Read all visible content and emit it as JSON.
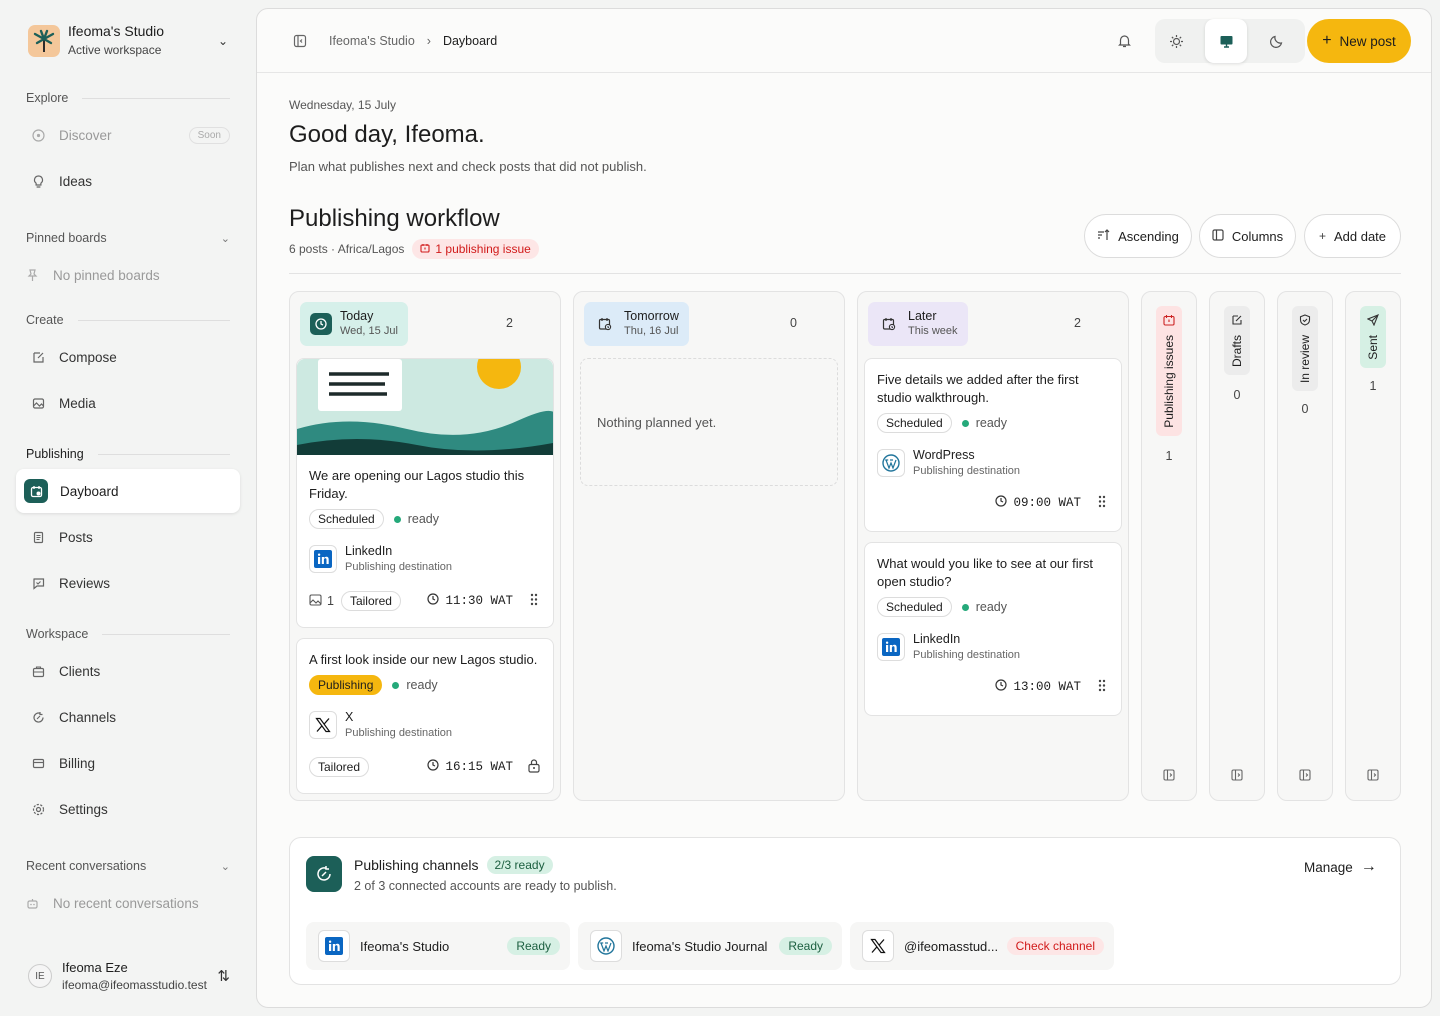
{
  "workspace": {
    "name": "Ifeoma's Studio",
    "subtitle": "Active workspace"
  },
  "sidebar": {
    "explore_label": "Explore",
    "discover": "Discover",
    "discover_badge": "Soon",
    "ideas": "Ideas",
    "pinned_label": "Pinned boards",
    "no_pinned": "No pinned boards",
    "create_label": "Create",
    "compose": "Compose",
    "media": "Media",
    "publishing_label": "Publishing",
    "dayboard": "Dayboard",
    "posts": "Posts",
    "reviews": "Reviews",
    "workspace_label": "Workspace",
    "clients": "Clients",
    "channels": "Channels",
    "billing": "Billing",
    "settings": "Settings",
    "recent_label": "Recent conversations",
    "no_recent": "No recent conversations"
  },
  "user": {
    "initials": "IE",
    "name": "Ifeoma Eze",
    "email": "ifeoma@ifeomasstudio.test"
  },
  "header": {
    "breadcrumb_root": "Ifeoma's Studio",
    "breadcrumb_current": "Dayboard",
    "new_post": "New post"
  },
  "page": {
    "date": "Wednesday, 15 July",
    "greeting": "Good day, Ifeoma.",
    "description": "Plan what publishes next and check posts that did not publish."
  },
  "workflow": {
    "title": "Publishing workflow",
    "meta": "6 posts · Africa/Lagos",
    "issue": "1 publishing issue",
    "sort": "Ascending",
    "columns": "Columns",
    "add_date": "Add date"
  },
  "columns": {
    "today": {
      "title": "Today",
      "sub": "Wed, 15 Jul",
      "count": "2",
      "color": "#d6f0ea"
    },
    "tomorrow": {
      "title": "Tomorrow",
      "sub": "Thu, 16 Jul",
      "count": "0",
      "empty": "Nothing planned yet.",
      "color": "#dcebf8"
    },
    "later": {
      "title": "Later",
      "sub": "This week",
      "count": "2",
      "color": "#ebe6f7"
    }
  },
  "cards": {
    "c1": {
      "text": "We are opening our Lagos studio this Friday.",
      "status": "Scheduled",
      "state": "ready",
      "channel": "LinkedIn",
      "dest": "Publishing destination",
      "media_count": "1",
      "tag": "Tailored",
      "time": "11:30 WAT"
    },
    "c2": {
      "text": "A first look inside our new Lagos studio.",
      "status": "Publishing",
      "state": "ready",
      "channel": "X",
      "dest": "Publishing destination",
      "tag": "Tailored",
      "time": "16:15 WAT"
    },
    "c3": {
      "text": "Five details we added after the first studio walkthrough.",
      "status": "Scheduled",
      "state": "ready",
      "channel": "WordPress",
      "dest": "Publishing destination",
      "time": "09:00 WAT"
    },
    "c4": {
      "text": "What would you like to see at our first open studio?",
      "status": "Scheduled",
      "state": "ready",
      "channel": "LinkedIn",
      "dest": "Publishing destination",
      "time": "13:00 WAT"
    }
  },
  "status_columns": {
    "issues": {
      "label": "Publishing issues",
      "count": "1",
      "color": "#fde3e3"
    },
    "drafts": {
      "label": "Drafts",
      "count": "0",
      "color": "#ececec"
    },
    "review": {
      "label": "In review",
      "count": "0",
      "color": "#ececec"
    },
    "sent": {
      "label": "Sent",
      "count": "1",
      "color": "#d6f0e4"
    }
  },
  "channels": {
    "title": "Publishing channels",
    "badge": "2/3 ready",
    "description": "2 of 3 connected accounts are ready to publish.",
    "manage": "Manage",
    "accounts": [
      {
        "name": "Ifeoma's Studio",
        "status": "Ready",
        "icon": "linkedin"
      },
      {
        "name": "Ifeoma's Studio Journal",
        "status": "Ready",
        "icon": "wordpress"
      },
      {
        "name": "@ifeomasstud...",
        "status": "Check channel",
        "icon": "x"
      }
    ]
  },
  "colors": {
    "accent": "#1c5f58",
    "primary_button": "#f5b70f",
    "ready": "#25a97a",
    "error": "#d11a1a"
  }
}
